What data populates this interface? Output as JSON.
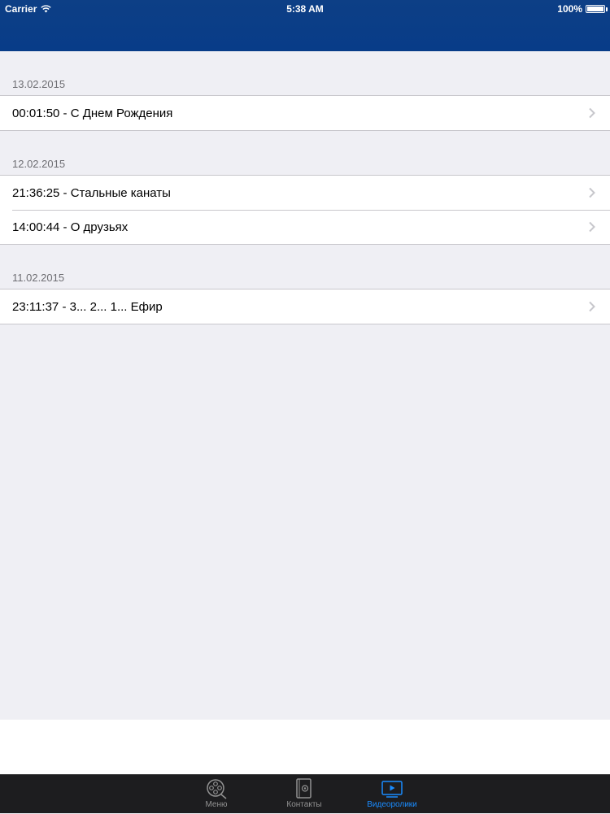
{
  "status_bar": {
    "carrier": "Carrier",
    "time": "5:38 AM",
    "battery": "100%"
  },
  "sections": [
    {
      "date": "13.02.2015",
      "items": [
        {
          "label": "00:01:50 - С Днем Рождения"
        }
      ]
    },
    {
      "date": "12.02.2015",
      "items": [
        {
          "label": "21:36:25 - Стальные канаты"
        },
        {
          "label": "14:00:44 - О друзьях"
        }
      ]
    },
    {
      "date": "11.02.2015",
      "items": [
        {
          "label": "23:11:37 - 3... 2... 1... Ефир"
        }
      ]
    }
  ],
  "tabbar": {
    "tabs": [
      {
        "label": "Меню",
        "icon": "film-reel-icon",
        "active": false
      },
      {
        "label": "Контакты",
        "icon": "contacts-book-icon",
        "active": false
      },
      {
        "label": "Видеоролики",
        "icon": "video-play-icon",
        "active": true
      }
    ]
  },
  "colors": {
    "nav_bar": "#083c88",
    "background": "#efeff4",
    "tab_active": "#1a8cff",
    "tab_inactive": "#929292",
    "tabbar_bg": "#1d1d1f"
  }
}
